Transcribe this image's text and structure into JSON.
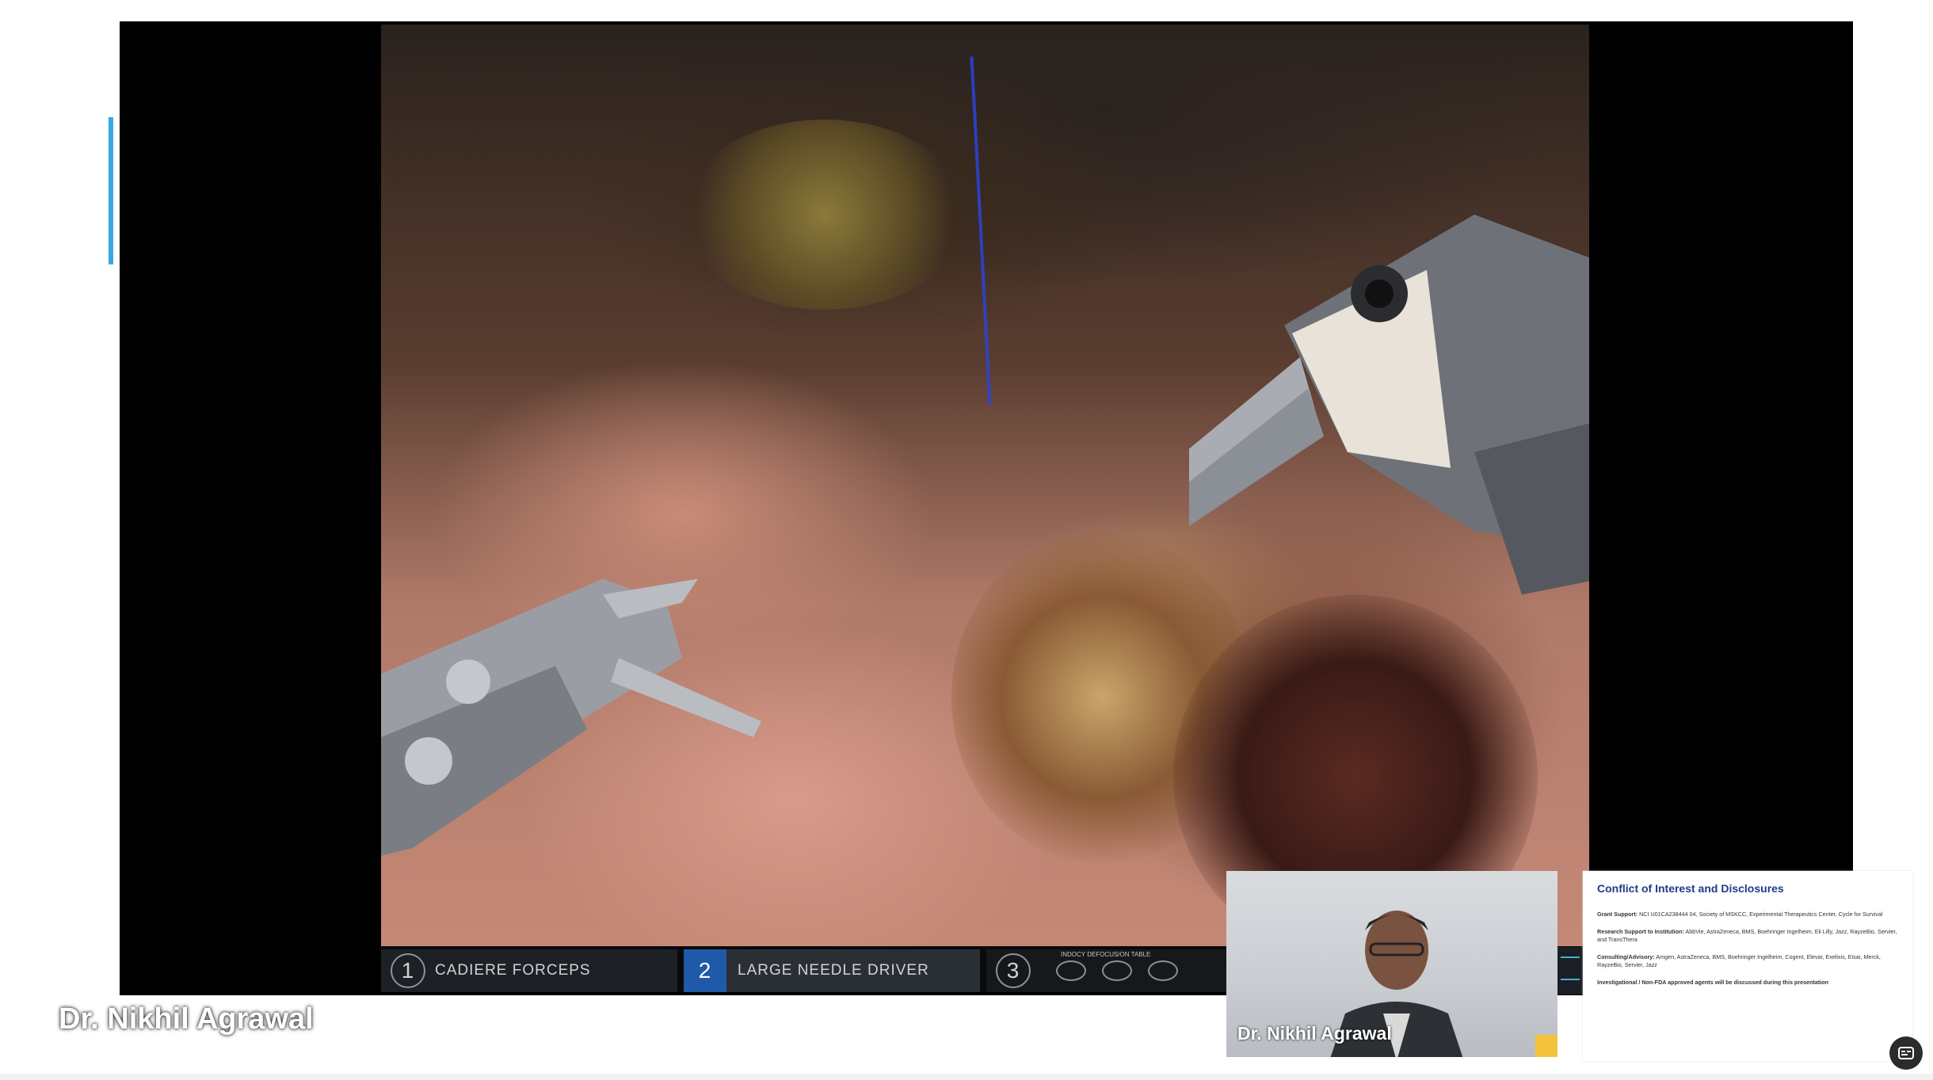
{
  "video": {
    "arms": [
      {
        "number": "1",
        "label": "CADIERE FORCEPS"
      },
      {
        "number": "2",
        "label": "LARGE NEEDLE DRIVER"
      },
      {
        "number": "3",
        "label": "INDOCY DEFOCUS/ON TABLE"
      }
    ]
  },
  "speaker": {
    "name": "Dr. Nikhil Agrawal",
    "icon": "screen-share-icon"
  },
  "webcam": {
    "name": "Dr. Nikhil Agrawal"
  },
  "slide": {
    "title": "Conflict of Interest and Disclosures",
    "items": [
      {
        "label": "Grant Support:",
        "text": "NCI U01CA238444 04, Society of MSKCC, Experimental Therapeutics Center, Cycle for Survival"
      },
      {
        "label": "Research Support to Institution:",
        "text": "AbbVie, AstraZeneca, BMS, Boehringer Ingelheim, Eli Lilly, Jazz, RayzeBio, Servier, and TransThera"
      },
      {
        "label": "Consulting/Advisory:",
        "text": "Amgen, AstraZeneca, BMS, Boehringer Ingelheim, Cogent, Elevar, Exelixis, Eisai, Merck, RayzeBio, Servier, Jazz"
      },
      {
        "label": "Investigational / Non-FDA approved agents will be discussed during this presentation",
        "text": ""
      }
    ]
  },
  "colors": {
    "accent_bar": "#36a9e1",
    "active_arm": "#1f5aa8",
    "slide_title": "#1f3c88"
  }
}
